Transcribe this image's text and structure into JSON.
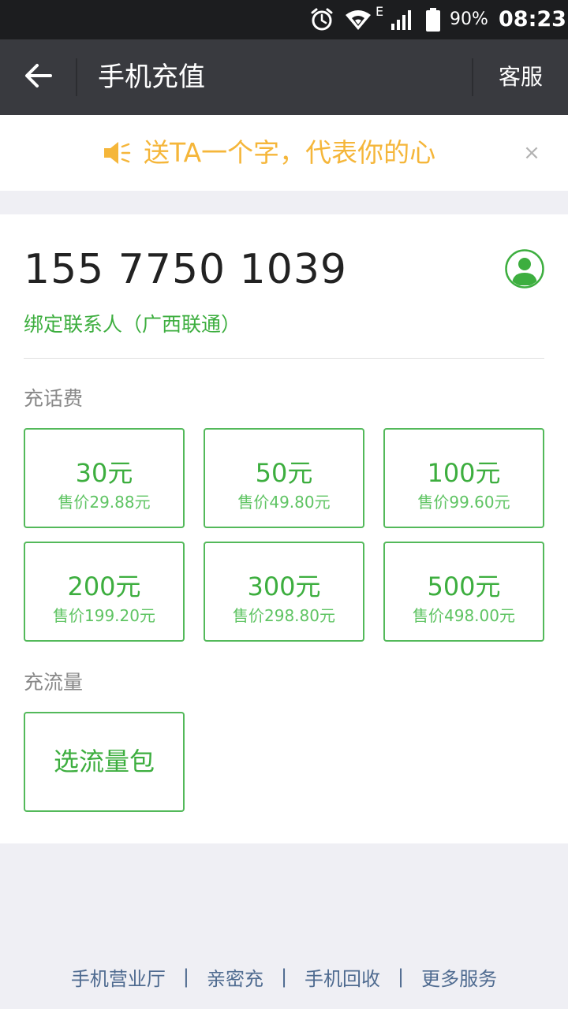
{
  "status_bar": {
    "network_type": "E",
    "battery_percent": "90%",
    "time": "08:23",
    "icons": [
      "alarm-icon",
      "wifi-icon",
      "signal-icon",
      "battery-icon"
    ]
  },
  "header": {
    "title": "手机充值",
    "right_action": "客服",
    "back_icon": "arrow-left-icon"
  },
  "notice": {
    "text": "送TA一个字，代表你的心",
    "close": "×",
    "icon": "speaker-icon",
    "color": "#f5b63a"
  },
  "account": {
    "phone_number": "155 7750 1039",
    "bind_info": "绑定联系人（广西联通）",
    "contact_icon": "contact-person-icon"
  },
  "recharge": {
    "section_label": "充话费",
    "options": [
      {
        "amount": "30元",
        "price": "售价29.88元"
      },
      {
        "amount": "50元",
        "price": "售价49.80元"
      },
      {
        "amount": "100元",
        "price": "售价99.60元"
      },
      {
        "amount": "200元",
        "price": "售价199.20元"
      },
      {
        "amount": "300元",
        "price": "售价298.80元"
      },
      {
        "amount": "500元",
        "price": "售价498.00元"
      }
    ]
  },
  "data_plan": {
    "section_label": "充流量",
    "button": "选流量包"
  },
  "footer": {
    "links": [
      "手机营业厅",
      "亲密充",
      "手机回收",
      "更多服务"
    ],
    "separator": "|"
  },
  "colors": {
    "accent_green": "#3dae3f",
    "title_bar": "#393a3f",
    "status_bar": "#1c1d1f",
    "footer_link": "#4f6b90"
  }
}
